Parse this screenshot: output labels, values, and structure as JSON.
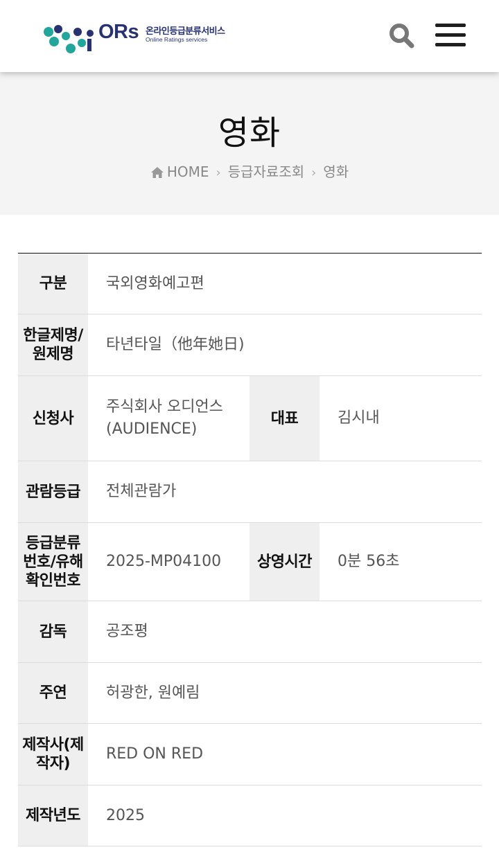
{
  "header": {
    "logo_korean": "온라인등급분류서비스",
    "logo_ors": "ORs",
    "logo_english": "Online Ratings services"
  },
  "banner": {
    "title": "영화",
    "breadcrumb": [
      "HOME",
      "등급자료조회",
      "영화"
    ]
  },
  "details": {
    "category_label": "구분",
    "category_value": "국외영화예고편",
    "title_label": "한글제명/원제명",
    "title_value": "타년타일（他年她日)",
    "applicant_label": "신청사",
    "applicant_value": "주식회사 오디언스 (AUDIENCE)",
    "representative_label": "대표",
    "representative_value": "김시내",
    "rating_label": "관람등급",
    "rating_value": "전체관람가",
    "number_label": "등급분류번호/유해확인번호",
    "number_value": "2025-MP04100",
    "runtime_label": "상영시간",
    "runtime_value": "0분 56초",
    "director_label": "감독",
    "director_value": "공조평",
    "cast_label": "주연",
    "cast_value": "허광한, 원예림",
    "producer_label": "제작사(제작자)",
    "producer_value": "RED ON RED",
    "year_label": "제작년도",
    "year_value": "2025"
  },
  "icons": {
    "search": "search-icon",
    "menu": "hamburger-menu-icon",
    "home": "home-icon",
    "separator": "chevron-right-icon"
  },
  "colors": {
    "brand_navy": "#273273",
    "brand_teal": "#1fa79b",
    "header_bg": "#ffffff",
    "banner_bg": "#f4f4f4",
    "label_bg": "#efefef"
  }
}
